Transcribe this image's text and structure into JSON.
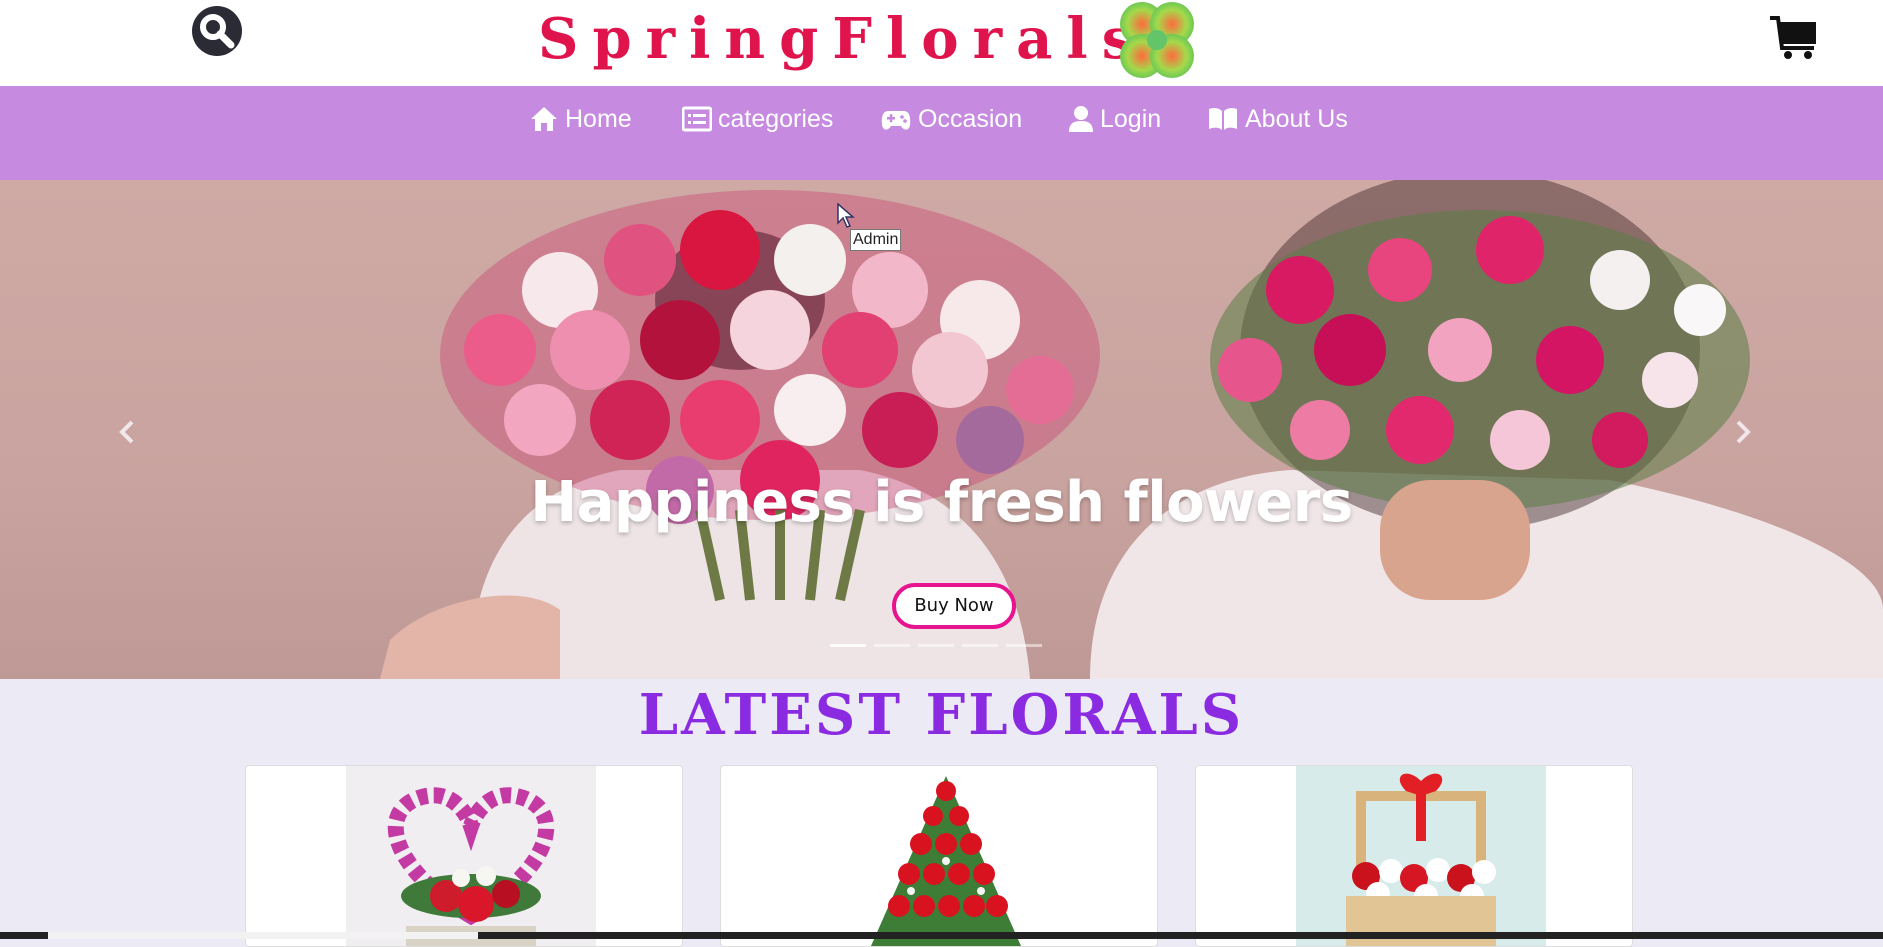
{
  "header": {
    "brand": "SpringFlorals",
    "search_icon": "search-icon",
    "cart_icon": "shopping-cart-icon",
    "brand_logo_icon": "clover-flower-logo"
  },
  "nav": {
    "items": [
      {
        "label": "Home",
        "icon": "home-icon"
      },
      {
        "label": "categories",
        "icon": "list-icon"
      },
      {
        "label": "Occasion",
        "icon": "gamepad-icon"
      },
      {
        "label": "Login",
        "icon": "user-icon"
      },
      {
        "label": "About Us",
        "icon": "book-icon"
      }
    ]
  },
  "hero": {
    "title": "Happiness is fresh flowers",
    "cta_label": "Buy Now",
    "slide_count": 5,
    "active_slide": 1
  },
  "tooltip": {
    "text": "Admin"
  },
  "latest": {
    "title": "LATEST FLORALS",
    "cards": [
      {
        "image": "orchid heart arrangement with red roses"
      },
      {
        "image": "red roses tower bouquet"
      },
      {
        "image": "wooden crate with red roses and white daisies"
      }
    ]
  },
  "colors": {
    "brand": "#e0144c",
    "nav_bg": "#c68ae0",
    "cta_border": "#e8138f",
    "section_title": "#8a2be2",
    "page_bg": "#ecebf5"
  }
}
